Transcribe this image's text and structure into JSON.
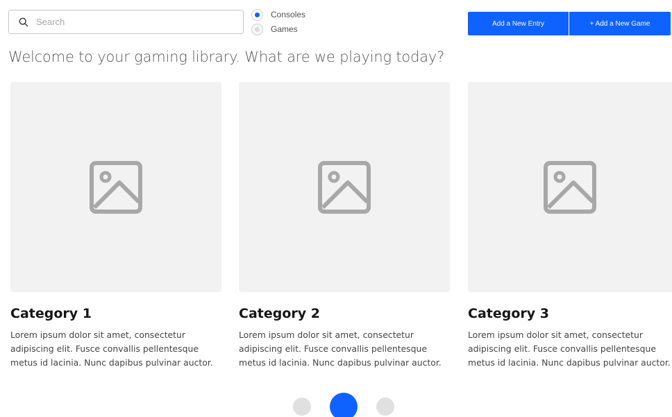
{
  "search": {
    "placeholder": "Search",
    "value": ""
  },
  "view_toggle": {
    "options": [
      {
        "label": "Consoles",
        "selected": true
      },
      {
        "label": "Games",
        "selected": false
      }
    ]
  },
  "actions": {
    "add_entry": "Add a New Entry",
    "add_game": "+ Add a New Game"
  },
  "welcome": "Welcome to your gaming library. What are we playing today?",
  "cards": [
    {
      "title": "Category 1",
      "text": "Lorem ipsum dolor sit amet, consectetur adipiscing elit. Fusce convallis pellentesque metus id lacinia. Nunc dapibus pulvinar auctor."
    },
    {
      "title": "Category 2",
      "text": "Lorem ipsum dolor sit amet, consectetur adipiscing elit. Fusce convallis pellentesque metus id lacinia. Nunc dapibus pulvinar auctor."
    },
    {
      "title": "Category 3",
      "text": "Lorem ipsum dolor sit amet, consectetur adipiscing elit. Fusce convallis pellentesque metus id lacinia. Nunc dapibus pulvinar auctor."
    }
  ],
  "pagination": {
    "pages": 3,
    "current": 2
  },
  "colors": {
    "accent": "#0f62fe",
    "placeholder_bg": "#f2f2f2",
    "placeholder_icon": "#a8a8a8"
  }
}
